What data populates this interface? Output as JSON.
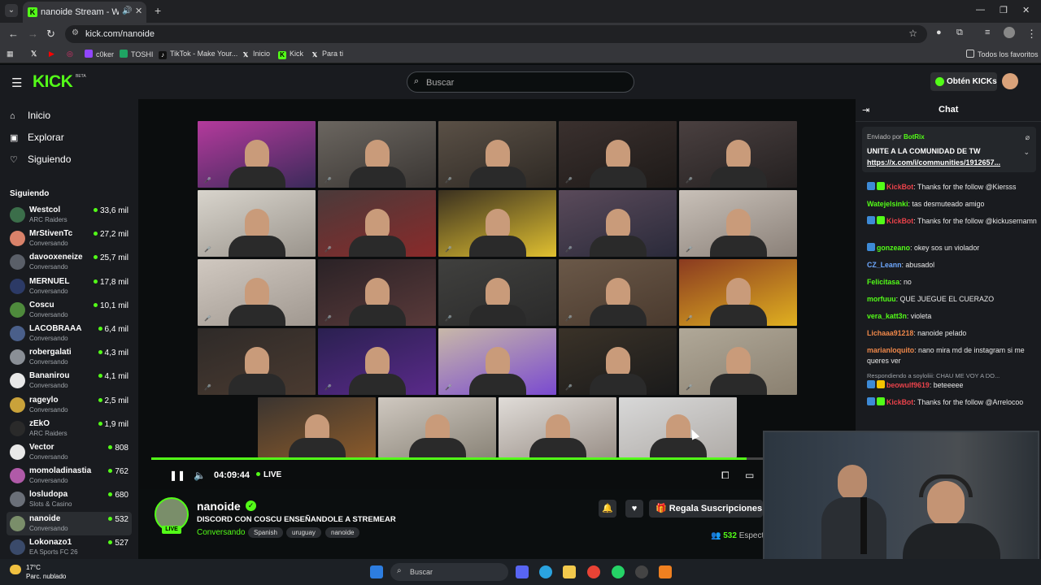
{
  "browser": {
    "tab_title": "nanoide Stream - Watch Li...",
    "url": "kick.com/nanoide",
    "bookmarks": [
      {
        "label": "c0ker",
        "icon": "twitch-icon",
        "color": "#9146ff"
      },
      {
        "label": "TOSHI",
        "icon": "sheets-icon",
        "color": "#1fa463"
      },
      {
        "label": "TikTok - Make Your...",
        "icon": "tiktok-icon",
        "color": "#111111"
      },
      {
        "label": "Inicio",
        "icon": "x-icon",
        "color": "#111111"
      },
      {
        "label": "Kick",
        "icon": "kick-icon",
        "color": "#53fc18"
      },
      {
        "label": "Para ti",
        "icon": "x-icon",
        "color": "#111111"
      }
    ],
    "all_bookmarks": "Todos los favoritos"
  },
  "header": {
    "logo": "KICK",
    "beta": "BETA",
    "search_placeholder": "Buscar",
    "kicks_button": "Obtén KICKs"
  },
  "sidebar": {
    "nav": [
      {
        "label": "Inicio",
        "icon": "home-icon"
      },
      {
        "label": "Explorar",
        "icon": "compass-icon"
      },
      {
        "label": "Siguiendo",
        "icon": "heart-icon"
      }
    ],
    "following_title": "Siguiendo",
    "following": [
      {
        "name": "Westcol",
        "category": "ARC Raiders",
        "viewers": "33,6 mil",
        "color": "#3b6e4a"
      },
      {
        "name": "MrStivenTc",
        "category": "Conversando",
        "viewers": "27,2 mil",
        "color": "#d9826a"
      },
      {
        "name": "davooxeneize",
        "category": "Conversando",
        "viewers": "25,7 mil",
        "color": "#5a5f68"
      },
      {
        "name": "MERNUEL",
        "category": "Conversando",
        "viewers": "17,8 mil",
        "color": "#2c3a66"
      },
      {
        "name": "Coscu",
        "category": "Conversando",
        "viewers": "10,1 mil",
        "color": "#4e8a3c"
      },
      {
        "name": "LACOBRAAA",
        "category": "Conversando",
        "viewers": "6,4 mil",
        "color": "#4a5f8a"
      },
      {
        "name": "robergalati",
        "category": "Conversando",
        "viewers": "4,3 mil",
        "color": "#8a8f96"
      },
      {
        "name": "Bananirou",
        "category": "Conversando",
        "viewers": "4,1 mil",
        "color": "#e8e8e8"
      },
      {
        "name": "rageylo",
        "category": "Conversando",
        "viewers": "2,5 mil",
        "color": "#c9a23a"
      },
      {
        "name": "zEkO",
        "category": "ARC Raiders",
        "viewers": "1,9 mil",
        "color": "#2a2a2a"
      },
      {
        "name": "Vector",
        "category": "Conversando",
        "viewers": "808",
        "color": "#e8e8e8"
      },
      {
        "name": "momoladinastia",
        "category": "Conversando",
        "viewers": "762",
        "color": "#b05aa8"
      },
      {
        "name": "losludopa",
        "category": "Slots & Casino",
        "viewers": "680",
        "color": "#6a6f78"
      },
      {
        "name": "nanoide",
        "category": "Conversando",
        "viewers": "532",
        "color": "#7a8e6a"
      },
      {
        "name": "Lokonazo1",
        "category": "EA Sports FC 26",
        "viewers": "527",
        "color": "#3a4a6a"
      }
    ]
  },
  "player": {
    "time": "04:09:44",
    "live": "LIVE",
    "progress": 0.95
  },
  "stream": {
    "channel": "nanoide",
    "live_badge": "LIVE",
    "title": "DISCORD CON COSCU ENSEÑANDOLE A STREMEAR",
    "category": "Conversando",
    "tags": [
      "Spanish",
      "uruguay",
      "nanoide"
    ],
    "gift_button": "Regala Suscripciones",
    "viewers_count": "532",
    "viewers_label": "Espect"
  },
  "chat": {
    "title": "Chat",
    "pinned": {
      "sent_by": "Enviado por",
      "bot": "BotRix",
      "message": "UNITE A LA COMUNIDAD DE TW",
      "link": "https://x.com/i/communities/1912657..."
    },
    "messages": [
      {
        "user": "KickBot",
        "color": "#e9424a",
        "text": ": Thanks for the follow @Kiersss",
        "badges": [
          "#3d8ad6",
          "#53fc18"
        ]
      },
      {
        "user": "Watejelsinki",
        "color": "#53fc18",
        "text": ": tas desmuteado amigo",
        "badges": []
      },
      {
        "user": "KickBot",
        "color": "#e9424a",
        "text": ": Thanks for the follow @kickusernamn",
        "badges": [
          "#3d8ad6",
          "#53fc18"
        ]
      },
      {
        "user": "gonzeano",
        "color": "#53fc18",
        "text": ": okey sos un violador",
        "badges": [
          "#3d8ad6"
        ]
      },
      {
        "user": "CZ_Leann",
        "color": "#6ea8ff",
        "text": ": abusadol",
        "badges": []
      },
      {
        "user": "Felicitasa",
        "color": "#53fc18",
        "text": ": no",
        "badges": []
      },
      {
        "user": "morfuuu",
        "color": "#53fc18",
        "text": ": QUE JUEGUE EL CUERAZO",
        "badges": []
      },
      {
        "user": "vera_katt3n",
        "color": "#53fc18",
        "text": ": violeta",
        "badges": []
      },
      {
        "user": "Lichaaa91218",
        "color": "#f0884a",
        "text": ": nanoide pelado",
        "badges": []
      },
      {
        "user": "marianloquito",
        "color": "#f0884a",
        "text": ": nano mira md de instagram si me queres ver",
        "badges": []
      },
      {
        "user": "",
        "color": "#9ea3a9",
        "text": "Respondiendo a soyloliii: CHAU ME VOY A DO...",
        "badges": []
      },
      {
        "user": "beowulf9619",
        "color": "#e9424a",
        "text": ": beteeeee",
        "badges": [
          "#3d8ad6",
          "#f5c400"
        ]
      },
      {
        "user": "KickBot",
        "color": "#e9424a",
        "text": ": Thanks for the follow @Arrelocoo",
        "badges": [
          "#3d8ad6",
          "#53fc18"
        ]
      }
    ]
  },
  "taskbar": {
    "temp": "17°C",
    "weather": "Parc. nublado",
    "search": "Buscar"
  }
}
